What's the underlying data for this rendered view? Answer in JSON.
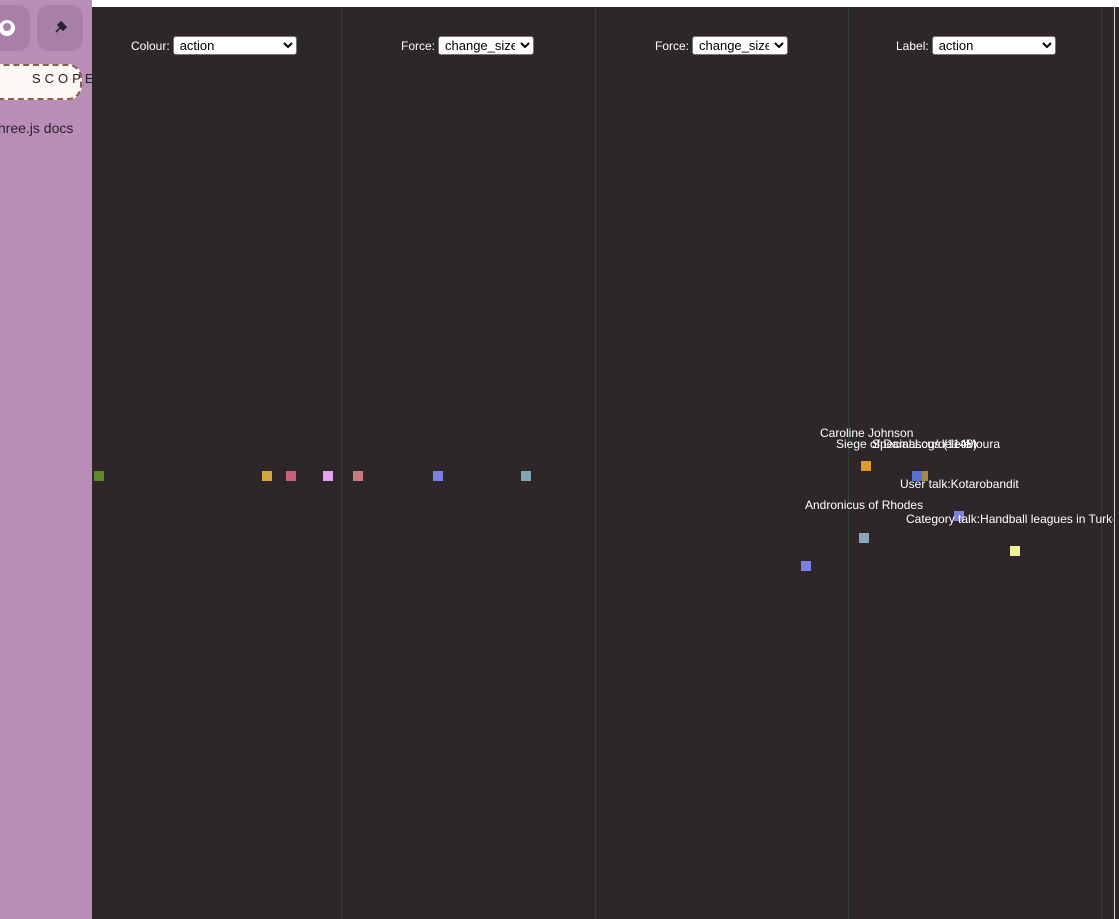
{
  "sidebar": {
    "github_icon": "github-icon",
    "pin_icon": "pin-icon",
    "scope_label": "SCOPE",
    "docs_link": "three.js docs"
  },
  "controls": [
    {
      "label": "Colour:",
      "value": "action"
    },
    {
      "label": "Force:",
      "value": "change_size"
    },
    {
      "label": "Force:",
      "value": "change_size"
    },
    {
      "label": "Label:",
      "value": "action"
    }
  ],
  "colors": {
    "background": "#2e272a",
    "sidebar": "#b98eb6"
  },
  "panel1_nodes": [
    "#5b8a27",
    "#d4a640",
    "#c9607a",
    "#e3a3f0"
  ],
  "panel2_nodes": [
    "#c97a80",
    "#7a7fe0",
    "#7fa6b5"
  ],
  "panel4_nodes": [
    "#e2992a",
    "#5a6fd4",
    "#7a7fe0",
    "#8aa7b8",
    "#7a7fe0",
    "#f0ef9a",
    "#a08a4a"
  ],
  "panel4_labels": [
    "Caroline Johnson",
    "Siege of Damascus (1148)",
    "Special:Log/delete",
    "Moura",
    "User talk:Kotarobandit",
    "Andronicus of Rhodes",
    "Category talk:Handball leagues in Turkey"
  ]
}
